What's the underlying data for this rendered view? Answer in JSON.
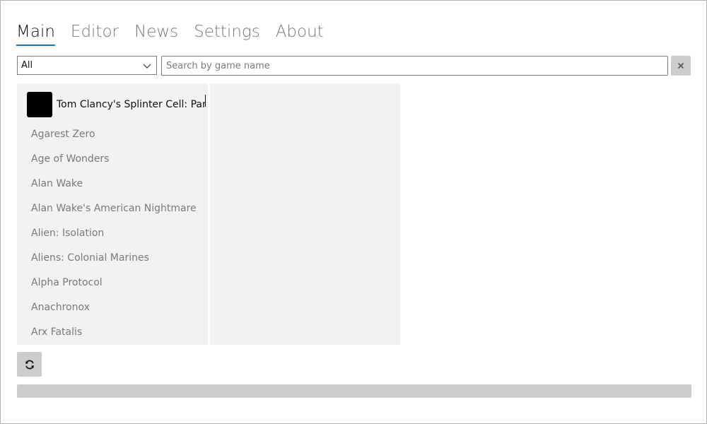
{
  "tabs": [
    {
      "label": "Main",
      "active": true
    },
    {
      "label": "Editor",
      "active": false
    },
    {
      "label": "News",
      "active": false
    },
    {
      "label": "Settings",
      "active": false
    },
    {
      "label": "About",
      "active": false
    }
  ],
  "filter": {
    "selected": "All"
  },
  "search": {
    "value": "",
    "placeholder": "Search by game name"
  },
  "selected_game": {
    "title": "Tom Clancy's Splinter Cell: Pandora Tomorrow"
  },
  "games": [
    "Agarest Zero",
    "Age of Wonders",
    "Alan Wake",
    "Alan Wake's American Nightmare",
    "Alien: Isolation",
    "Aliens: Colonial Marines",
    "Alpha Protocol",
    "Anachronox",
    "Arx Fatalis"
  ],
  "icons": {
    "filter_chevron": "chevron-down-icon",
    "clear": "close-icon",
    "refresh": "refresh-icon"
  },
  "progress": {
    "value": 0
  },
  "colors": {
    "accent": "#1e73be",
    "panel_bg": "#f2f2f2",
    "button_bg": "#cccccc",
    "muted_text": "#7a7a7a"
  }
}
